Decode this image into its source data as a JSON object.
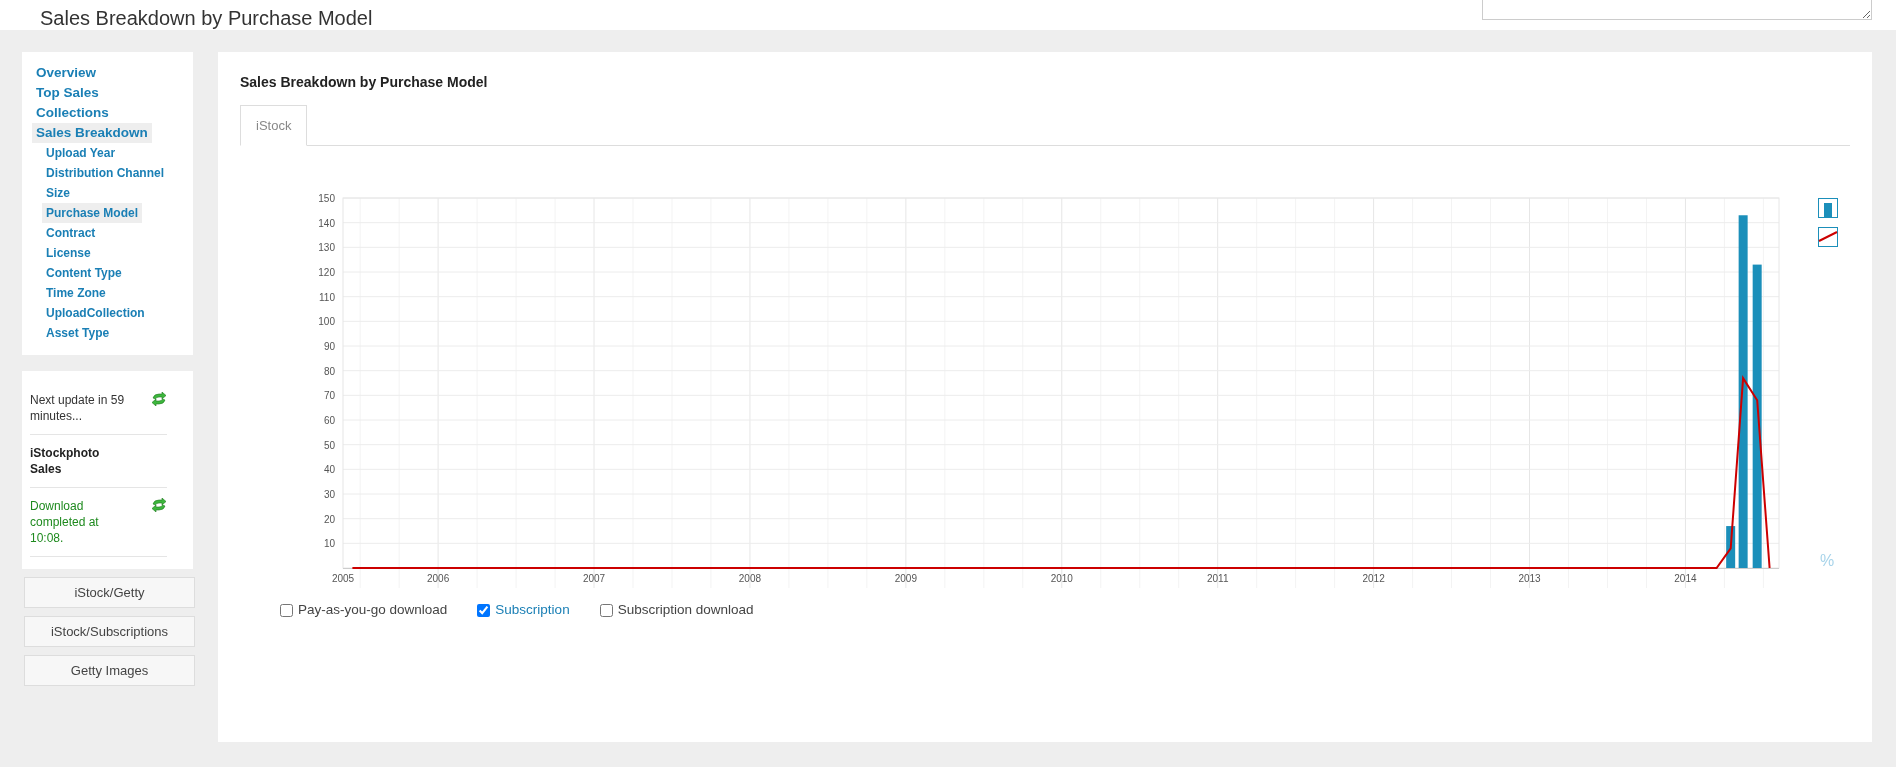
{
  "header": {
    "title": "Sales Breakdown by Purchase Model"
  },
  "sidebar": {
    "nav": [
      {
        "label": "Overview",
        "selected": false
      },
      {
        "label": "Top Sales",
        "selected": false
      },
      {
        "label": "Collections",
        "selected": false
      },
      {
        "label": "Sales Breakdown",
        "selected": true,
        "children": [
          {
            "label": "Upload Year",
            "selected": false
          },
          {
            "label": "Distribution Channel",
            "selected": false
          },
          {
            "label": "Size",
            "selected": false
          },
          {
            "label": "Purchase Model",
            "selected": true
          },
          {
            "label": "Contract",
            "selected": false
          },
          {
            "label": "License",
            "selected": false
          },
          {
            "label": "Content Type",
            "selected": false
          },
          {
            "label": "Time Zone",
            "selected": false
          },
          {
            "label": "UploadCollection",
            "selected": false
          },
          {
            "label": "Asset Type",
            "selected": false
          }
        ]
      }
    ],
    "status": [
      {
        "kind": "info",
        "text": "Next update in 59 minutes...",
        "refresh": true
      },
      {
        "kind": "heading",
        "text": "iStockphoto Sales",
        "refresh": false
      },
      {
        "kind": "success",
        "text": "Download completed at 10:08.",
        "refresh": true
      }
    ],
    "buttons": [
      "iStock/Getty",
      "iStock/Subscriptions",
      "Getty Images"
    ]
  },
  "main": {
    "title": "Sales Breakdown by Purchase Model",
    "tabs": [
      {
        "label": "iStock",
        "selected": true
      }
    ],
    "chart": {
      "unit_label": "%",
      "chart_data": {
        "type": "bar",
        "x": [
          2005.45,
          2014.2,
          2014.29,
          2014.37,
          2014.46,
          2014.54
        ],
        "series": [
          {
            "color": "#1b8fba",
            "values": [
              null,
              null,
              17,
              143,
              123,
              null
            ]
          },
          {
            "type": "line",
            "color": "#cc0000",
            "values": [
              0,
              0,
              8,
              77,
              68,
              0
            ]
          }
        ],
        "xlim": [
          2005.39,
          2014.6
        ],
        "ylim": [
          0,
          150
        ],
        "grid": true,
        "xticks": [
          {
            "value": 2005.39,
            "label": "2005"
          },
          2006,
          2007,
          2008,
          2009,
          2010,
          2011,
          2012,
          2013,
          2014
        ],
        "yticks": [
          10,
          20,
          30,
          40,
          50,
          60,
          70,
          80,
          90,
          100,
          110,
          120,
          130,
          140,
          150
        ]
      }
    },
    "filters": [
      {
        "label": "Pay-as-you-go download",
        "checked": false
      },
      {
        "label": "Subscription",
        "checked": true
      },
      {
        "label": "Subscription download",
        "checked": false
      }
    ]
  }
}
